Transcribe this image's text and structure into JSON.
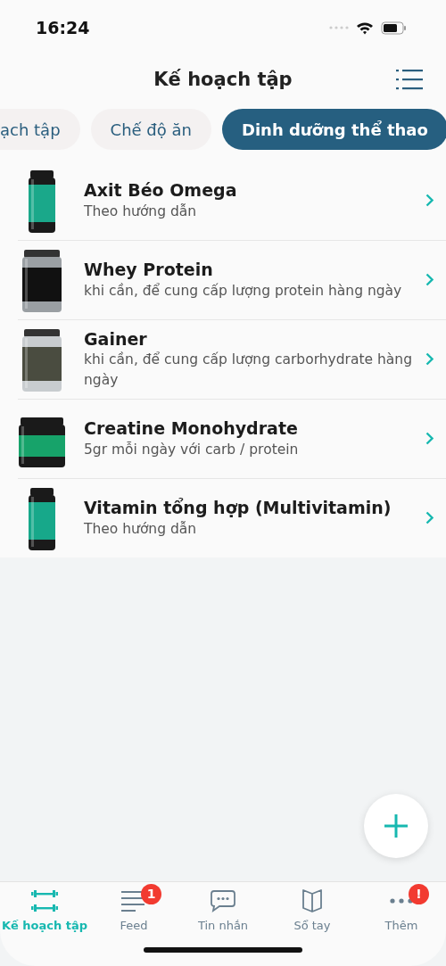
{
  "status_bar": {
    "time": "16:24"
  },
  "header": {
    "title": "Kế hoạch tập"
  },
  "tabs": [
    {
      "label": "ạch tập",
      "selected": false
    },
    {
      "label": "Chế độ ăn",
      "selected": false
    },
    {
      "label": "Dinh dưỡng thể thao",
      "selected": true
    }
  ],
  "supplements": [
    {
      "name": "Axit Béo Omega",
      "dosage": "Theo hướng dẫn"
    },
    {
      "name": "Whey Protein",
      "dosage": "khi cần, để cung cấp lượng protein hàng ngày"
    },
    {
      "name": "Gainer",
      "dosage": "khi cần, để cung cấp lượng carborhydrate hàng ngày"
    },
    {
      "name": "Creatine Monohydrate",
      "dosage": "5gr mỗi ngày với carb / protein"
    },
    {
      "name": "Vitamin tổng hợp (Multivitamin)",
      "dosage": "Theo hướng dẫn"
    }
  ],
  "bottom_nav": [
    {
      "label": "Kế hoạch tập",
      "kind": "dumbbell",
      "selected": true
    },
    {
      "label": "Feed",
      "kind": "feed",
      "selected": false,
      "badge": "1"
    },
    {
      "label": "Tin nhắn",
      "kind": "chat",
      "selected": false
    },
    {
      "label": "Sổ tay",
      "kind": "book",
      "selected": false
    },
    {
      "label": "Thêm",
      "kind": "more",
      "selected": false,
      "badge": "!"
    }
  ]
}
